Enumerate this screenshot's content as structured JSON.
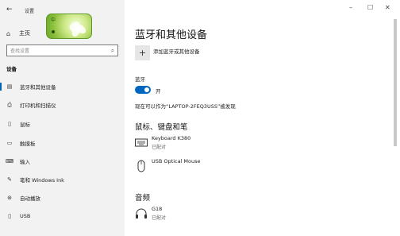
{
  "window": {
    "app_title": "设置",
    "controls": {
      "minimize": "–",
      "maximize": "☐",
      "close": "✕"
    }
  },
  "sidebar": {
    "back_glyph": "←",
    "home_label": "主页",
    "search_placeholder": "查找设置",
    "section_title": "设备",
    "items": [
      {
        "label": "蓝牙和其他设备",
        "icon": "bluetooth-devices-icon",
        "active": true
      },
      {
        "label": "打印机和扫描仪",
        "icon": "printer-icon",
        "active": false
      },
      {
        "label": "鼠标",
        "icon": "mouse-icon",
        "active": false
      },
      {
        "label": "触摸板",
        "icon": "touchpad-icon",
        "active": false
      },
      {
        "label": "输入",
        "icon": "keyboard-icon",
        "active": false
      },
      {
        "label": "笔和 Windows Ink",
        "icon": "pen-icon",
        "active": false
      },
      {
        "label": "自动播放",
        "icon": "autoplay-icon",
        "active": false
      },
      {
        "label": "USB",
        "icon": "usb-icon",
        "active": false
      }
    ]
  },
  "sticker": {
    "text": "中"
  },
  "main": {
    "title": "蓝牙和其他设备",
    "add_device_label": "添加蓝牙或其他设备",
    "bluetooth": {
      "label": "蓝牙",
      "state": "开",
      "on": true
    },
    "discoverable_text": "现在可以作为“LAPTOP-2FEQ3USS”被发现",
    "mouse_keyboard_pen": {
      "title": "鼠标、键盘和笔",
      "devices": [
        {
          "name": "Keyboard K380",
          "status": "已配对",
          "icon": "keyboard-icon"
        },
        {
          "name": "USB Optical Mouse",
          "status": "",
          "icon": "mouse-icon"
        }
      ]
    },
    "audio": {
      "title": "音频",
      "devices": [
        {
          "name": "G18",
          "status": "已配对",
          "icon": "headset-icon"
        }
      ]
    }
  },
  "colors": {
    "accent": "#0067c0",
    "sidebar_bg": "#f2f2f2"
  }
}
